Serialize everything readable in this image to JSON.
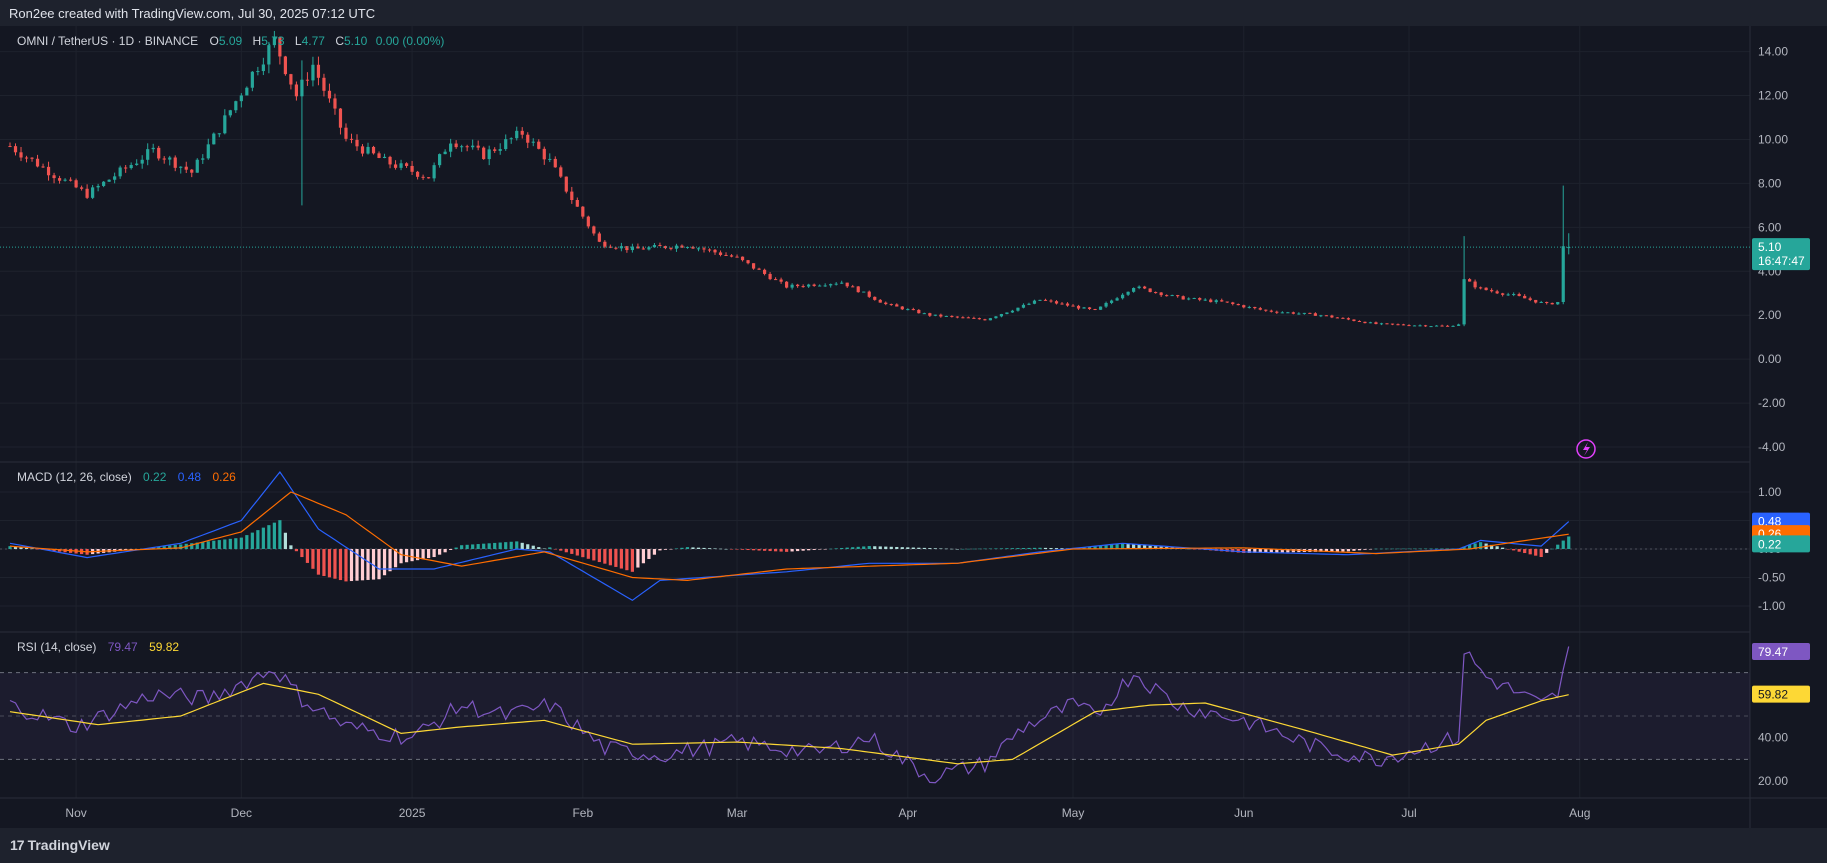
{
  "header": {
    "credit": "Ron2ee created with TradingView.com, Jul 30, 2025 07:12 UTC"
  },
  "legend": {
    "symbol": "OMNI / TetherUS · 1D · BINANCE",
    "o_label": "O",
    "o_val": "5.09",
    "h_label": "H",
    "h_val": "5.73",
    "l_label": "L",
    "l_val": "4.77",
    "c_label": "C",
    "c_val": "5.10",
    "chg": "0.00 (0.00%)"
  },
  "price_badge": {
    "price": "5.10",
    "countdown": "16:47:47"
  },
  "macd": {
    "label": "MACD (12, 26, close)",
    "hist": "0.22",
    "macd": "0.48",
    "signal": "0.26"
  },
  "rsi": {
    "label": "RSI (14, close)",
    "rsi": "79.47",
    "ma": "59.82"
  },
  "footer": {
    "brand": "TradingView",
    "mark": "17"
  },
  "colors": {
    "up": "#26a69a",
    "down": "#ef5350",
    "macd": "#2962ff",
    "signal": "#ff6d00",
    "rsi": "#7e57c2",
    "rsi_ma": "#fdd835",
    "bg": "#141722"
  },
  "chart_data": [
    {
      "type": "candlestick",
      "title": "OMNI / TetherUS · 1D · BINANCE",
      "x_ticks": [
        "Nov",
        "Dec",
        "2025",
        "Feb",
        "Mar",
        "Apr",
        "May",
        "Jun",
        "Jul",
        "Aug"
      ],
      "x_tick_dates": [
        "2024-11-01",
        "2024-12-01",
        "2025-01-01",
        "2025-02-01",
        "2025-03-01",
        "2025-04-01",
        "2025-05-01",
        "2025-06-01",
        "2025-07-01",
        "2025-08-01"
      ],
      "y_ticks": [
        "14.00",
        "12.00",
        "10.00",
        "8.00",
        "6.00",
        "4.00",
        "2.00",
        "0.00",
        "-2.00",
        "-4.00"
      ],
      "ylim": [
        -4.5,
        14.8
      ],
      "close_anchors": [
        [
          "2024-10-20",
          9.7
        ],
        [
          "2024-10-28",
          8.4
        ],
        [
          "2024-11-03",
          7.5
        ],
        [
          "2024-11-10",
          8.7
        ],
        [
          "2024-11-15",
          9.5
        ],
        [
          "2024-11-22",
          8.5
        ],
        [
          "2024-11-27",
          10.5
        ],
        [
          "2024-12-03",
          13.0
        ],
        [
          "2024-12-07",
          14.5
        ],
        [
          "2024-12-11",
          12.0
        ],
        [
          "2024-12-14",
          13.4
        ],
        [
          "2024-12-20",
          10.0
        ],
        [
          "2024-12-27",
          9.0
        ],
        [
          "2025-01-04",
          8.3
        ],
        [
          "2025-01-08",
          10.0
        ],
        [
          "2025-01-14",
          9.3
        ],
        [
          "2025-01-21",
          10.3
        ],
        [
          "2025-01-26",
          9.0
        ],
        [
          "2025-01-30",
          7.3
        ],
        [
          "2025-02-04",
          5.3
        ],
        [
          "2025-02-10",
          5.0
        ],
        [
          "2025-02-20",
          5.2
        ],
        [
          "2025-03-01",
          4.6
        ],
        [
          "2025-03-10",
          3.3
        ],
        [
          "2025-03-20",
          3.5
        ],
        [
          "2025-03-28",
          2.5
        ],
        [
          "2025-04-05",
          2.0
        ],
        [
          "2025-04-15",
          1.8
        ],
        [
          "2025-04-25",
          2.7
        ],
        [
          "2025-05-05",
          2.2
        ],
        [
          "2025-05-12",
          3.3
        ],
        [
          "2025-05-20",
          2.8
        ],
        [
          "2025-05-28",
          2.6
        ],
        [
          "2025-06-05",
          2.2
        ],
        [
          "2025-06-15",
          2.0
        ],
        [
          "2025-06-25",
          1.6
        ],
        [
          "2025-07-08",
          1.5
        ],
        [
          "2025-07-10",
          1.6
        ],
        [
          "2025-07-11",
          3.6
        ],
        [
          "2025-07-14",
          3.2
        ],
        [
          "2025-07-20",
          2.9
        ],
        [
          "2025-07-26",
          2.5
        ],
        [
          "2025-07-28",
          2.6
        ],
        [
          "2025-07-29",
          5.09
        ],
        [
          "2025-07-30",
          5.1
        ]
      ],
      "special_candles": [
        {
          "date": "2024-12-12",
          "high": 13.6,
          "low": 7.0
        },
        {
          "date": "2025-07-11",
          "high": 5.6,
          "low": 1.5
        },
        {
          "date": "2025-07-29",
          "high": 7.9,
          "low": 2.5
        },
        {
          "date": "2025-07-30",
          "open": 5.09,
          "high": 5.73,
          "low": 4.77,
          "close": 5.1
        }
      ],
      "last_price": 5.1
    },
    {
      "type": "line",
      "title": "MACD (12, 26, close)",
      "y_ticks": [
        "1.00",
        "0.50",
        "0.00",
        "-0.50",
        "-1.00"
      ],
      "ylim": [
        -1.35,
        1.35
      ],
      "series": [
        {
          "name": "MACD",
          "anchors": [
            [
              "2024-10-20",
              0.1
            ],
            [
              "2024-11-03",
              -0.15
            ],
            [
              "2024-11-20",
              0.1
            ],
            [
              "2024-12-01",
              0.5
            ],
            [
              "2024-12-08",
              1.35
            ],
            [
              "2024-12-15",
              0.35
            ],
            [
              "2024-12-26",
              -0.35
            ],
            [
              "2025-01-05",
              -0.35
            ],
            [
              "2025-01-20",
              0.0
            ],
            [
              "2025-01-26",
              -0.05
            ],
            [
              "2025-02-10",
              -0.9
            ],
            [
              "2025-02-15",
              -0.55
            ],
            [
              "2025-03-10",
              -0.4
            ],
            [
              "2025-03-25",
              -0.25
            ],
            [
              "2025-04-10",
              -0.25
            ],
            [
              "2025-04-25",
              -0.05
            ],
            [
              "2025-05-10",
              0.1
            ],
            [
              "2025-06-01",
              -0.05
            ],
            [
              "2025-06-20",
              -0.1
            ],
            [
              "2025-07-10",
              0.0
            ],
            [
              "2025-07-14",
              0.15
            ],
            [
              "2025-07-25",
              0.05
            ],
            [
              "2025-07-30",
              0.48
            ]
          ]
        },
        {
          "name": "Signal",
          "anchors": [
            [
              "2024-10-20",
              0.05
            ],
            [
              "2024-11-03",
              -0.05
            ],
            [
              "2024-11-20",
              0.02
            ],
            [
              "2024-12-01",
              0.3
            ],
            [
              "2024-12-10",
              1.0
            ],
            [
              "2024-12-20",
              0.6
            ],
            [
              "2024-12-30",
              -0.1
            ],
            [
              "2025-01-10",
              -0.3
            ],
            [
              "2025-01-25",
              -0.05
            ],
            [
              "2025-02-10",
              -0.5
            ],
            [
              "2025-02-20",
              -0.55
            ],
            [
              "2025-03-10",
              -0.35
            ],
            [
              "2025-04-10",
              -0.25
            ],
            [
              "2025-05-01",
              0.0
            ],
            [
              "2025-06-01",
              0.02
            ],
            [
              "2025-06-25",
              -0.08
            ],
            [
              "2025-07-12",
              0.0
            ],
            [
              "2025-07-20",
              0.12
            ],
            [
              "2025-07-30",
              0.26
            ]
          ]
        }
      ],
      "histogram_last": 0.22
    },
    {
      "type": "line",
      "title": "RSI (14, close)",
      "y_ticks": [
        "79.47",
        "59.82",
        "40.00",
        "20.00"
      ],
      "bands": [
        70,
        50,
        30
      ],
      "ylim": [
        15,
        85
      ],
      "series": [
        {
          "name": "RSI",
          "anchors": [
            [
              "2024-10-20",
              55
            ],
            [
              "2024-11-01",
              45
            ],
            [
              "2024-11-15",
              60
            ],
            [
              "2024-11-25",
              58
            ],
            [
              "2024-12-07",
              72
            ],
            [
              "2024-12-12",
              58
            ],
            [
              "2024-12-20",
              45
            ],
            [
              "2025-01-01",
              40
            ],
            [
              "2025-01-10",
              55
            ],
            [
              "2025-01-18",
              50
            ],
            [
              "2025-01-26",
              55
            ],
            [
              "2025-02-05",
              35
            ],
            [
              "2025-02-15",
              32
            ],
            [
              "2025-03-01",
              38
            ],
            [
              "2025-03-15",
              33
            ],
            [
              "2025-03-25",
              40
            ],
            [
              "2025-04-05",
              22
            ],
            [
              "2025-04-15",
              28
            ],
            [
              "2025-04-22",
              45
            ],
            [
              "2025-05-01",
              55
            ],
            [
              "2025-05-05",
              50
            ],
            [
              "2025-05-12",
              70
            ],
            [
              "2025-05-20",
              55
            ],
            [
              "2025-06-01",
              48
            ],
            [
              "2025-06-15",
              35
            ],
            [
              "2025-06-25",
              30
            ],
            [
              "2025-07-10",
              40
            ],
            [
              "2025-07-11",
              80
            ],
            [
              "2025-07-15",
              68
            ],
            [
              "2025-07-25",
              55
            ],
            [
              "2025-07-28",
              60
            ],
            [
              "2025-07-30",
              79.47
            ]
          ]
        },
        {
          "name": "RSI MA",
          "anchors": [
            [
              "2024-10-20",
              52
            ],
            [
              "2024-11-05",
              46
            ],
            [
              "2024-11-20",
              50
            ],
            [
              "2024-12-05",
              65
            ],
            [
              "2024-12-15",
              60
            ],
            [
              "2024-12-30",
              42
            ],
            [
              "2025-01-10",
              45
            ],
            [
              "2025-01-25",
              48
            ],
            [
              "2025-02-10",
              37
            ],
            [
              "2025-03-01",
              38
            ],
            [
              "2025-03-20",
              35
            ],
            [
              "2025-04-10",
              28
            ],
            [
              "2025-04-20",
              30
            ],
            [
              "2025-05-05",
              52
            ],
            [
              "2025-05-15",
              55
            ],
            [
              "2025-05-25",
              56
            ],
            [
              "2025-06-10",
              45
            ],
            [
              "2025-06-28",
              32
            ],
            [
              "2025-07-10",
              37
            ],
            [
              "2025-07-15",
              48
            ],
            [
              "2025-07-25",
              57
            ],
            [
              "2025-07-30",
              59.82
            ]
          ]
        }
      ]
    }
  ]
}
